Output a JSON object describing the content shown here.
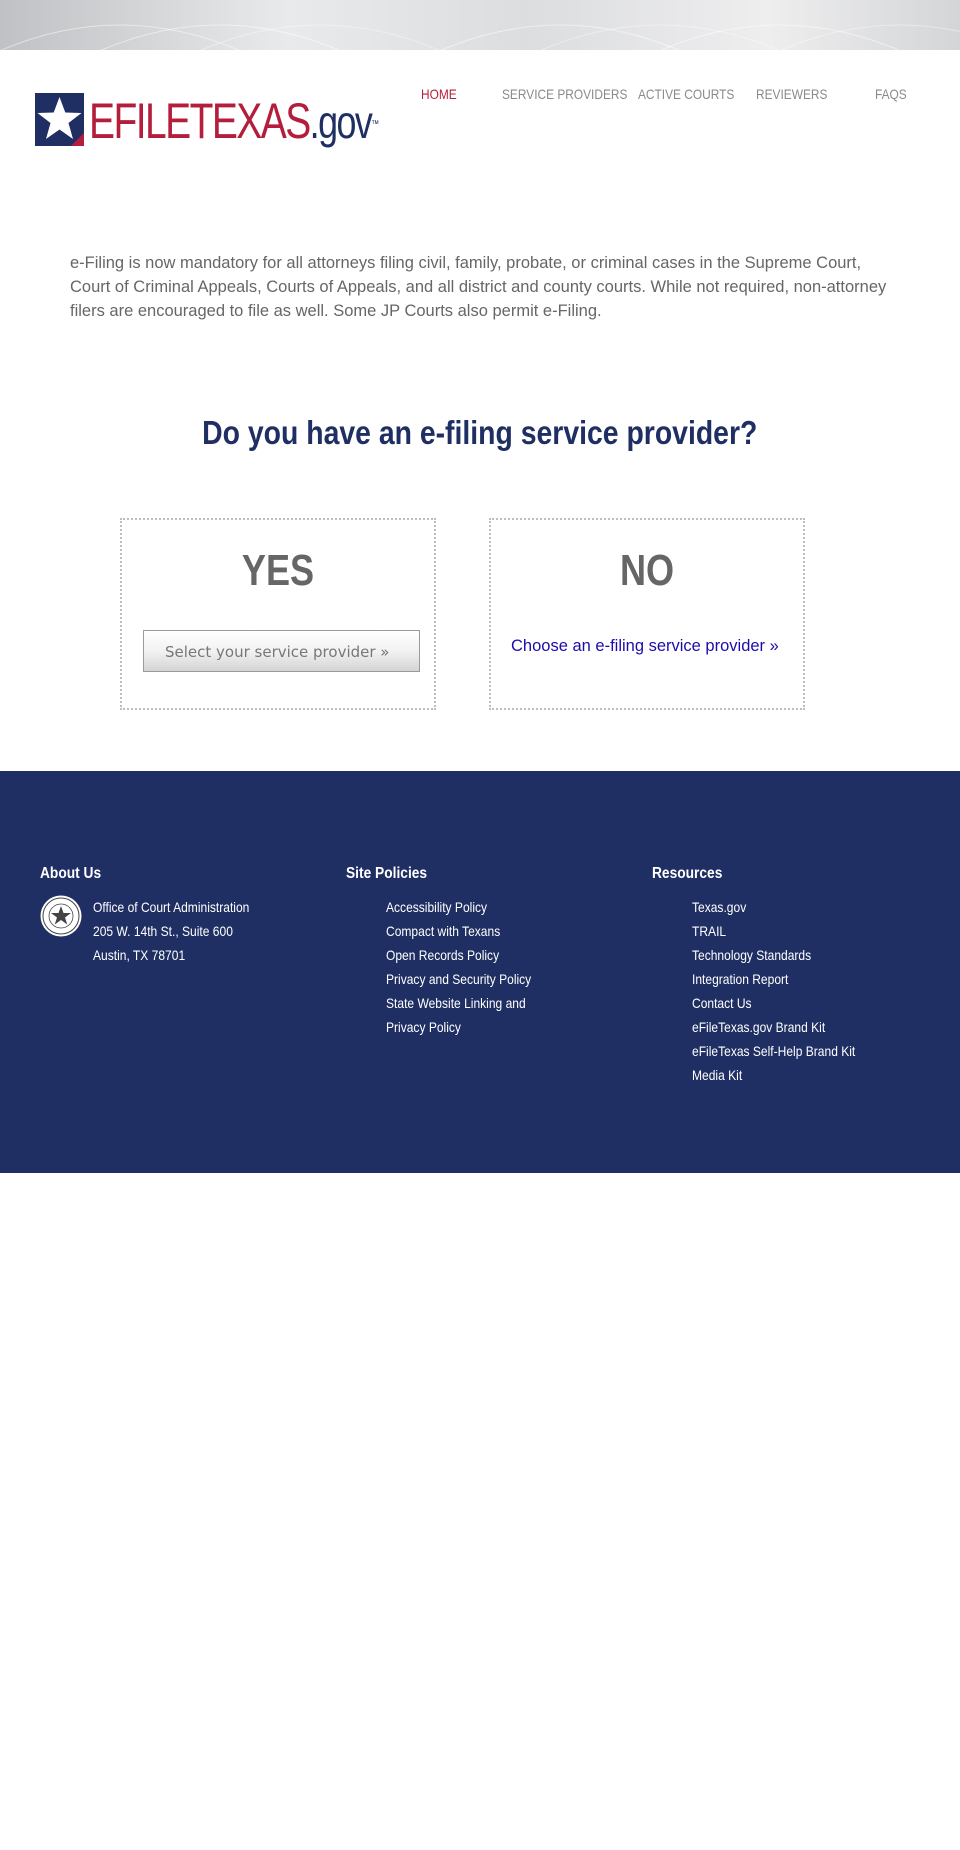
{
  "logo": {
    "efile": "EFILE",
    "texas": "TEXAS",
    "gov": ".gov",
    "tm": "™"
  },
  "nav": {
    "items": [
      {
        "label": "HOME",
        "active": true
      },
      {
        "label": "SERVICE PROVIDERS",
        "active": false
      },
      {
        "label": "ACTIVE COURTS",
        "active": false
      },
      {
        "label": "REVIEWERS",
        "active": false
      },
      {
        "label": "FAQS",
        "active": false
      }
    ]
  },
  "intro": "e-Filing is now mandatory for all attorneys filing civil, family, probate, or criminal cases in the Supreme Court, Court of Criminal Appeals, Courts of Appeals, and all district and county courts. While not required, non-attorney filers are encouraged to file as well. Some JP Courts also permit e-Filing.",
  "question": "Do you have an e-filing service provider?",
  "yes_box": {
    "title": "YES",
    "button_label": "Select your service provider »"
  },
  "no_box": {
    "title": "NO",
    "link_label": "Choose an e-filing service provider »"
  },
  "footer": {
    "about": {
      "heading": "About Us",
      "address": [
        "Office of Court Administration",
        "205 W. 14th St., Suite 600",
        "Austin, TX 78701"
      ]
    },
    "policies": {
      "heading": "Site Policies",
      "items": [
        "Accessibility Policy",
        "Compact with Texans",
        "Open Records Policy",
        "Privacy and Security Policy",
        "State Website Linking and",
        "Privacy Policy"
      ]
    },
    "resources": {
      "heading": "Resources",
      "items": [
        "Texas.gov",
        "TRAIL",
        "Technology Standards",
        "Integration Report",
        "Contact Us",
        "eFileTexas.gov Brand Kit",
        "eFileTexas Self-Help Brand Kit",
        "Media Kit"
      ]
    }
  },
  "colors": {
    "navy": "#1f2f63",
    "red": "#b41e3c",
    "gray_text": "#666666",
    "link_blue": "#1a0dab"
  }
}
